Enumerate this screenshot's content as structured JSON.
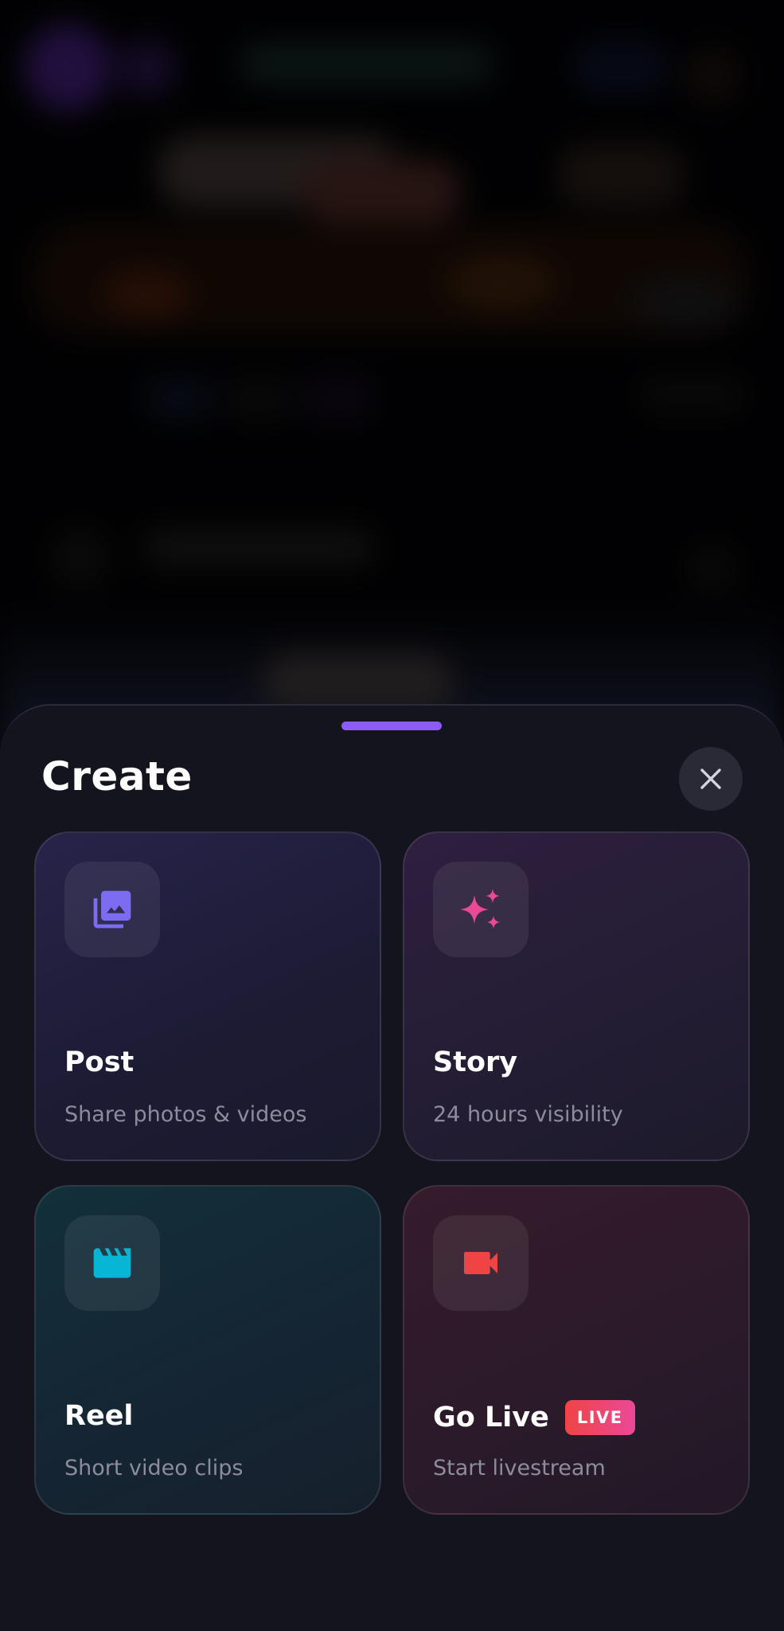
{
  "sheet": {
    "title": "Create",
    "close_icon": "close-icon",
    "accent_color": "#8b5cf6"
  },
  "options": {
    "post": {
      "title": "Post",
      "subtitle": "Share photos & videos",
      "icon": "photo-library-icon",
      "icon_color": "#7c6cf2"
    },
    "story": {
      "title": "Story",
      "subtitle": "24 hours visibility",
      "icon": "sparkles-icon",
      "icon_color": "#ec4899"
    },
    "reel": {
      "title": "Reel",
      "subtitle": "Short video clips",
      "icon": "clapperboard-icon",
      "icon_color": "#06b6d4"
    },
    "live": {
      "title": "Go Live",
      "subtitle": "Start livestream",
      "icon": "video-camera-icon",
      "icon_color": "#ef4444",
      "badge": "LIVE"
    }
  }
}
